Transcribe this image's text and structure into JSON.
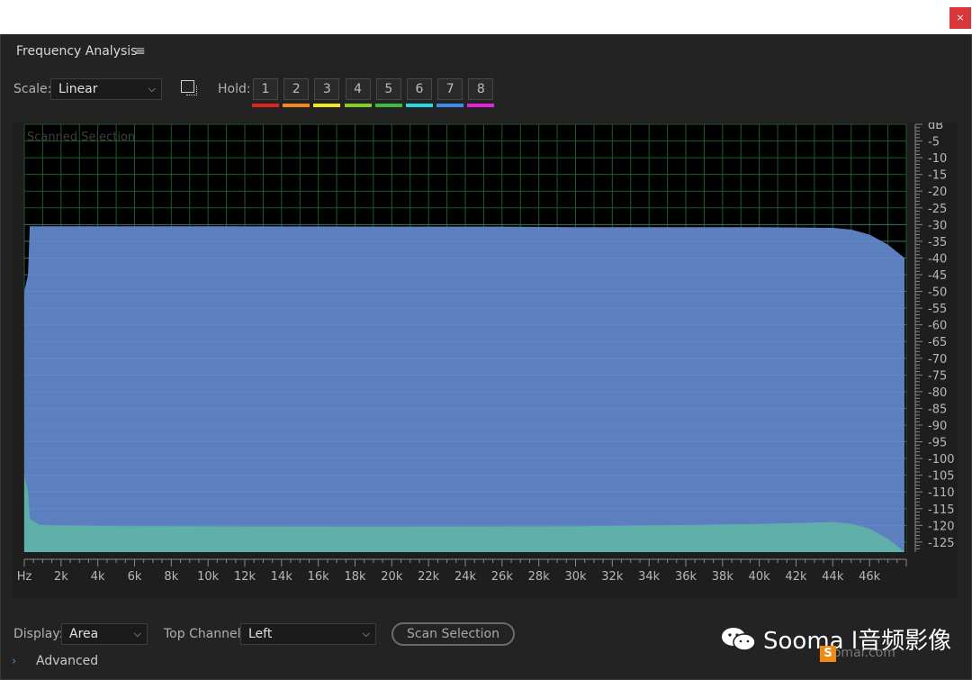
{
  "window": {
    "close_glyph": "×"
  },
  "panel": {
    "title": "Frequency Analysis",
    "menu_icon": "≡"
  },
  "toolbar": {
    "scale_label": "Scale:",
    "scale_value": "Linear",
    "hold_label": "Hold:",
    "hold_buttons": [
      {
        "label": "1",
        "color": "#e0221f"
      },
      {
        "label": "2",
        "color": "#f08a1d"
      },
      {
        "label": "3",
        "color": "#f2e81f"
      },
      {
        "label": "4",
        "color": "#7fd01f"
      },
      {
        "label": "5",
        "color": "#3fbd3c"
      },
      {
        "label": "6",
        "color": "#27d8e6"
      },
      {
        "label": "7",
        "color": "#3c8ee8"
      },
      {
        "label": "8",
        "color": "#e024d6"
      }
    ]
  },
  "chart_data": {
    "type": "area",
    "title": "Scanned Selection",
    "xlabel": "Hz",
    "ylabel": "dB",
    "x_ticks": [
      "Hz",
      "2k",
      "4k",
      "6k",
      "8k",
      "10k",
      "12k",
      "14k",
      "16k",
      "18k",
      "20k",
      "22k",
      "24k",
      "26k",
      "28k",
      "30k",
      "32k",
      "34k",
      "36k",
      "38k",
      "40k",
      "42k",
      "44k",
      "46k"
    ],
    "y_ticks": [
      "dB",
      "-5",
      "-10",
      "-15",
      "-20",
      "-25",
      "-30",
      "-35",
      "-40",
      "-45",
      "-50",
      "-55",
      "-60",
      "-65",
      "-70",
      "-75",
      "-80",
      "-85",
      "-90",
      "-95",
      "-100",
      "-105",
      "-110",
      "-115",
      "-120",
      "-125"
    ],
    "xlim": [
      0,
      48000
    ],
    "ylim": [
      -128,
      0
    ],
    "grid": true,
    "colors": {
      "upper": "#5c7fc0",
      "lower": "#5fb0a8",
      "grid": "#1f5a2a",
      "background": "#000000"
    },
    "series": [
      {
        "x": [
          0,
          200,
          300,
          1000,
          5000,
          10000,
          20000,
          26000,
          30000,
          40000,
          43000,
          44000,
          45000,
          46000,
          47000,
          47900
        ],
        "y": [
          -50,
          -45,
          -30.5,
          -30.5,
          -30.5,
          -30.5,
          -30.6,
          -30.6,
          -30.8,
          -30.8,
          -30.9,
          -31,
          -31.5,
          -33,
          -36,
          -40
        ]
      },
      {
        "x": [
          0,
          200,
          300,
          800,
          1500,
          5000,
          10000,
          20000,
          30000,
          40000,
          43000,
          44000,
          45000,
          46000,
          47000,
          47900
        ],
        "y": [
          -105,
          -110,
          -118,
          -119.8,
          -120,
          -120.2,
          -120.3,
          -120.4,
          -120.3,
          -119.6,
          -119.2,
          -119,
          -119.5,
          -121,
          -124,
          -128
        ]
      }
    ]
  },
  "bottom": {
    "display_label": "Display:",
    "display_value": "Area",
    "channel_label": "Top Channel:",
    "channel_value": "Left",
    "scan_button": "Scan Selection",
    "advanced_label": "Advanced",
    "advanced_chevron": "›"
  },
  "watermark": {
    "text": "Sooma l音频影像",
    "subtext": "soomal.com",
    "logo_letter": "S"
  }
}
